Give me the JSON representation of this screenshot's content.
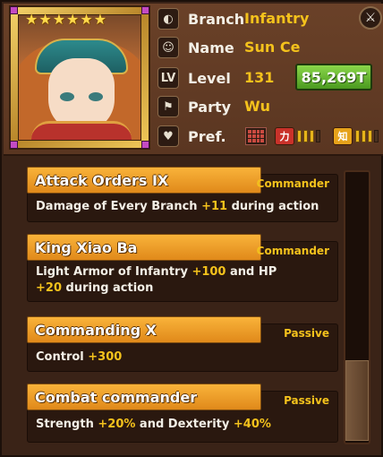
{
  "general": {
    "stars": 6,
    "branch_label": "Branch",
    "branch_value": "Infantry",
    "name_label": "Name",
    "name_value": "Sun Ce",
    "level_label": "Level",
    "level_value": "131",
    "level_icon_text": "LV",
    "power_value": "85,269T",
    "party_label": "Party",
    "party_value": "Wu",
    "pref_label": "Pref.",
    "pref_badges": [
      {
        "text": "力",
        "color": "#c9322a",
        "filled": 3,
        "total": 4
      },
      {
        "text": "知",
        "color": "#e6a21a",
        "filled": 3,
        "total": 4
      }
    ]
  },
  "skills": [
    {
      "title": "Attack Orders IX",
      "type": "Commander",
      "desc_parts": [
        "Damage of Every Branch ",
        "+11",
        " during action"
      ]
    },
    {
      "title": "King Xiao Ba",
      "type": "Commander",
      "desc_parts": [
        "Light Armor of Infantry ",
        "+100",
        " and HP ",
        "+20",
        " during action"
      ]
    },
    {
      "title": "Commanding X",
      "type": "Passive",
      "desc_parts": [
        "Control ",
        "+300"
      ]
    },
    {
      "title": "Combat commander",
      "type": "Passive",
      "desc_parts": [
        "Strength ",
        "+20%",
        " and Dexterity ",
        "+40%"
      ]
    }
  ],
  "colors": {
    "accent_gold": "#f4c21c",
    "power_green": "#4b9a20",
    "skill_header_orange": "#f0a02a"
  }
}
